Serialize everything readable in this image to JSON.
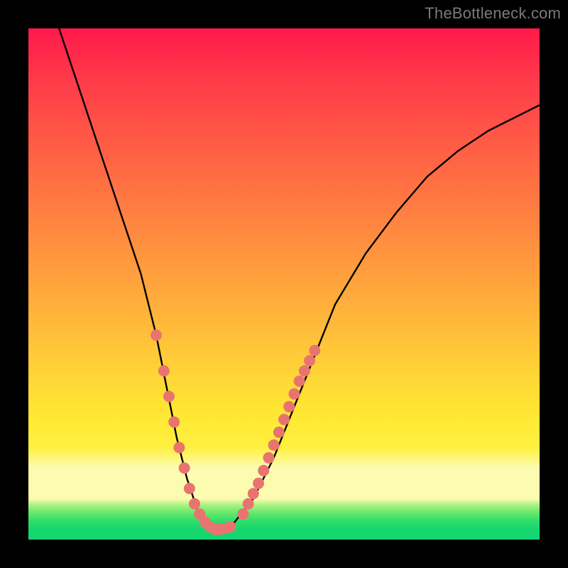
{
  "watermark": "TheBottleneck.com",
  "colors": {
    "frame": "#000000",
    "gradient_top": "#ff1a4b",
    "gradient_mid": "#ffd636",
    "gradient_pale": "#fcfcb0",
    "gradient_green": "#12d572",
    "curve": "#000000",
    "dot": "#e9746f"
  },
  "chart_data": {
    "type": "line",
    "title": "",
    "xlabel": "",
    "ylabel": "",
    "xlim": [
      0,
      100
    ],
    "ylim": [
      0,
      100
    ],
    "series": [
      {
        "name": "bottleneck-curve",
        "x": [
          6,
          10,
          14,
          18,
          22,
          25,
          27,
          29,
          31,
          33,
          35,
          37,
          40,
          44,
          48,
          52,
          56,
          60,
          66,
          72,
          78,
          84,
          90,
          96,
          100
        ],
        "y": [
          100,
          88,
          76,
          64,
          52,
          40,
          30,
          20,
          12,
          6,
          3,
          2,
          3,
          8,
          16,
          26,
          36,
          46,
          56,
          64,
          71,
          76,
          80,
          83,
          85
        ]
      }
    ],
    "dots_left": [
      {
        "x": 25,
        "y": 40
      },
      {
        "x": 26.5,
        "y": 33
      },
      {
        "x": 27.5,
        "y": 28
      },
      {
        "x": 28.5,
        "y": 23
      },
      {
        "x": 29.5,
        "y": 18
      },
      {
        "x": 30.5,
        "y": 14
      },
      {
        "x": 31.5,
        "y": 10
      },
      {
        "x": 32.5,
        "y": 7
      },
      {
        "x": 33.5,
        "y": 5
      },
      {
        "x": 34.5,
        "y": 3.5
      },
      {
        "x": 35.5,
        "y": 2.5
      },
      {
        "x": 36.5,
        "y": 2
      },
      {
        "x": 37.5,
        "y": 2
      },
      {
        "x": 38.5,
        "y": 2.2
      },
      {
        "x": 39.5,
        "y": 2.5
      }
    ],
    "dots_right": [
      {
        "x": 42,
        "y": 5
      },
      {
        "x": 43,
        "y": 7
      },
      {
        "x": 44,
        "y": 9
      },
      {
        "x": 45,
        "y": 11
      },
      {
        "x": 46,
        "y": 13.5
      },
      {
        "x": 47,
        "y": 16
      },
      {
        "x": 48,
        "y": 18.5
      },
      {
        "x": 49,
        "y": 21
      },
      {
        "x": 50,
        "y": 23.5
      },
      {
        "x": 51,
        "y": 26
      },
      {
        "x": 52,
        "y": 28.5
      },
      {
        "x": 53,
        "y": 31
      },
      {
        "x": 54,
        "y": 33
      },
      {
        "x": 55,
        "y": 35
      },
      {
        "x": 56,
        "y": 37
      }
    ]
  }
}
